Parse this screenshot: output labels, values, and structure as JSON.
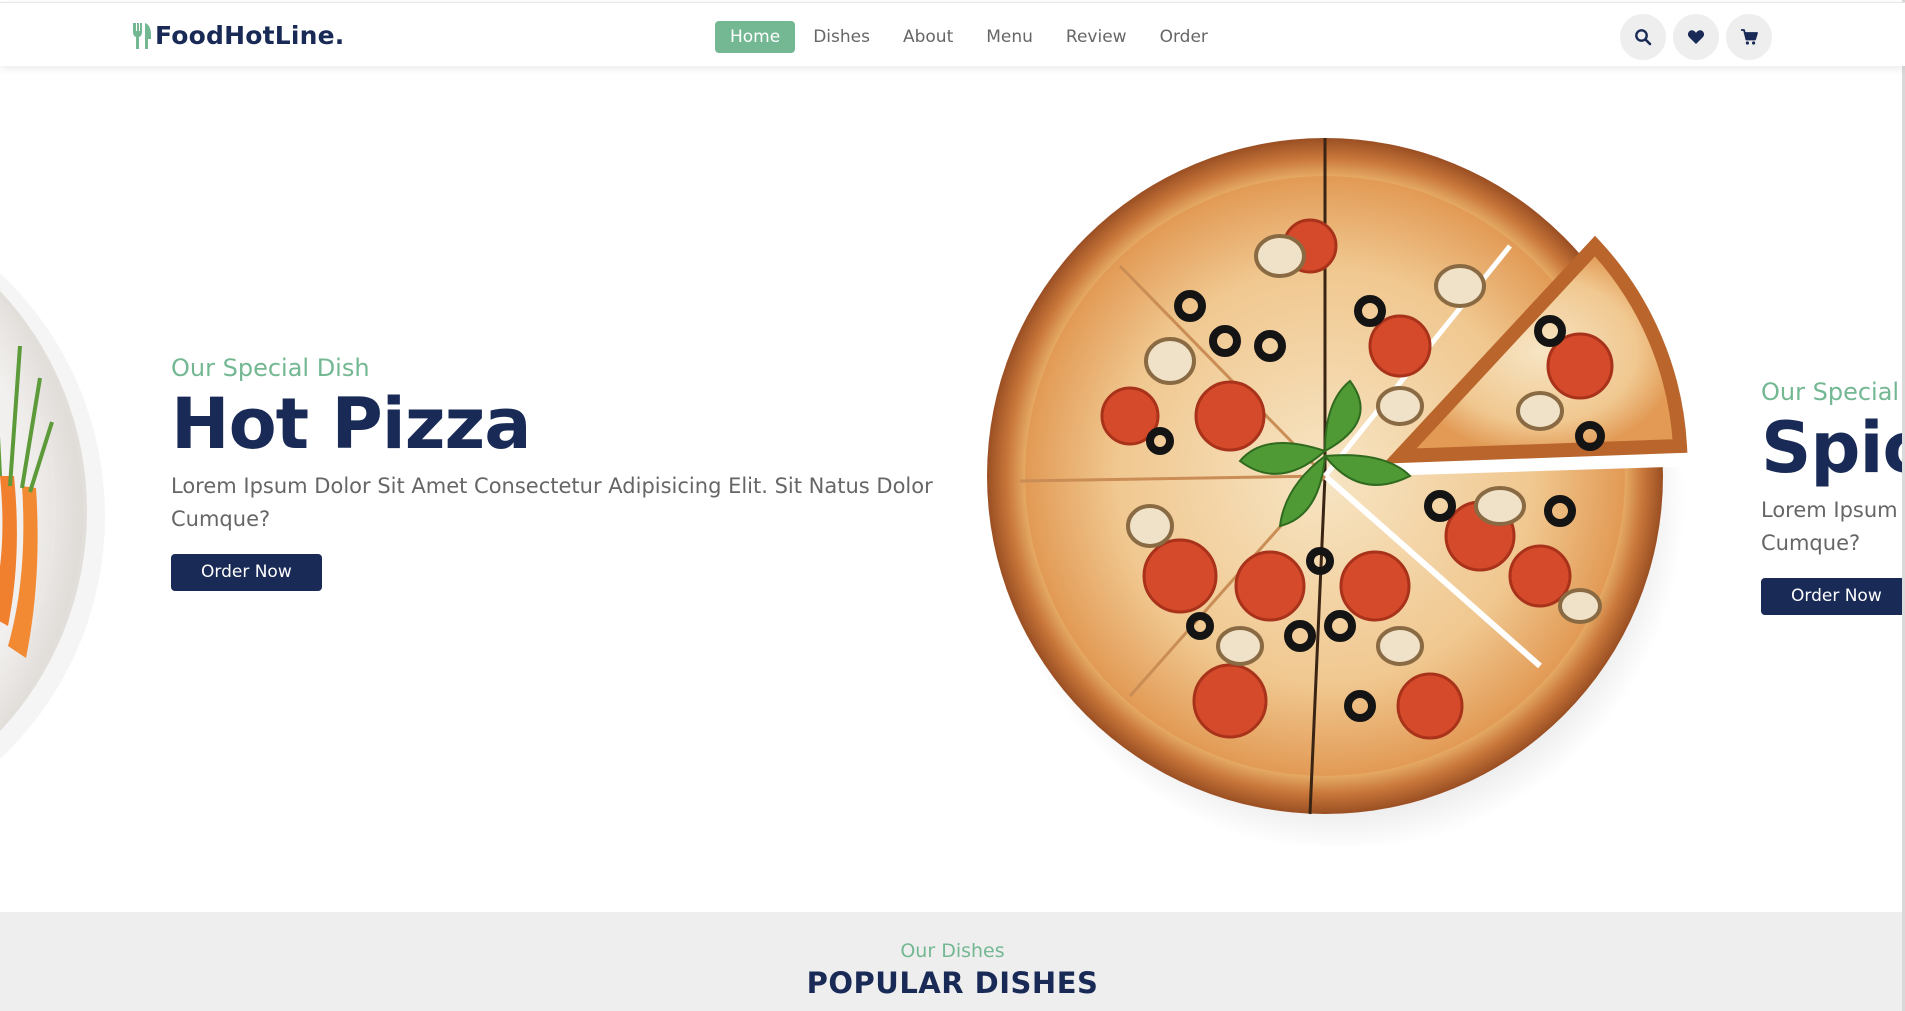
{
  "brand": {
    "name": "FoodHotLine.",
    "accent_color": "#74b893",
    "primary_color": "#192a56"
  },
  "nav": {
    "items": [
      {
        "label": "Home",
        "active": true
      },
      {
        "label": "Dishes",
        "active": false
      },
      {
        "label": "About",
        "active": false
      },
      {
        "label": "Menu",
        "active": false
      },
      {
        "label": "Review",
        "active": false
      },
      {
        "label": "Order",
        "active": false
      }
    ]
  },
  "header_icons": [
    "search-icon",
    "heart-icon",
    "cart-icon"
  ],
  "hero": {
    "current": {
      "subtitle": "Our Special Dish",
      "title": "Hot Pizza",
      "description": "Lorem Ipsum Dolor Sit Amet Consectetur Adipisicing Elit. Sit Natus Dolor Cumque?",
      "button": "Order Now"
    },
    "next": {
      "subtitle": "Our Special",
      "title": "Spic",
      "description": "Lorem Ipsum Cumque?",
      "button": "Order Now"
    }
  },
  "popular": {
    "subtitle": "Our Dishes",
    "title": "POPULAR DISHES"
  }
}
